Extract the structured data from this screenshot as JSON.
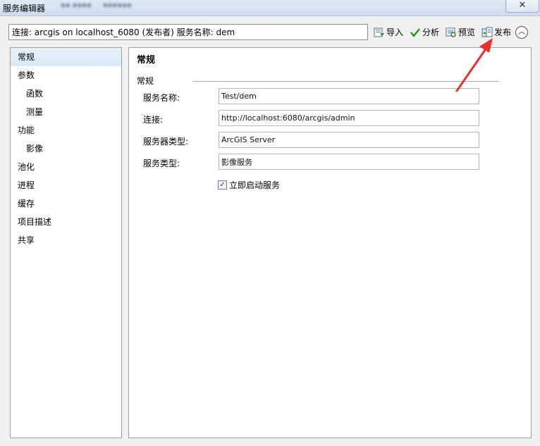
{
  "window": {
    "title": "服务编辑器",
    "close_glyph": "✕"
  },
  "toolbar": {
    "connection_text": "连接: arcgis on localhost_6080 (发布者)    服务名称: dem",
    "import_label": "导入",
    "analyze_label": "分析",
    "preview_label": "预览",
    "publish_label": "发布",
    "collapse_glyph": "︿"
  },
  "nav": {
    "items": [
      {
        "label": "常规"
      },
      {
        "label": "参数"
      },
      {
        "label": "函数"
      },
      {
        "label": "测量"
      },
      {
        "label": "功能"
      },
      {
        "label": "影像"
      },
      {
        "label": "池化"
      },
      {
        "label": "进程"
      },
      {
        "label": "缓存"
      },
      {
        "label": "项目描述"
      },
      {
        "label": "共享"
      }
    ]
  },
  "main": {
    "title": "常规",
    "group_label": "常规",
    "fields": [
      {
        "label": "服务名称:",
        "value": "Test/dem"
      },
      {
        "label": "连接:",
        "value": "http://localhost:6080/arcgis/admin"
      },
      {
        "label": "服务器类型:",
        "value": "ArcGIS Server"
      },
      {
        "label": "服务类型:",
        "value": "影像服务"
      }
    ],
    "autostart": {
      "label": "立即启动服务",
      "checked": true,
      "check_glyph": "✓"
    }
  },
  "icons": {
    "import": "import-icon",
    "analyze": "checkmark-icon",
    "preview": "preview-icon",
    "publish": "publish-icon"
  },
  "colors": {
    "selection": "#d7e8f8",
    "annotation_arrow": "#e8312f",
    "analyze_check": "#2e8b1f"
  }
}
